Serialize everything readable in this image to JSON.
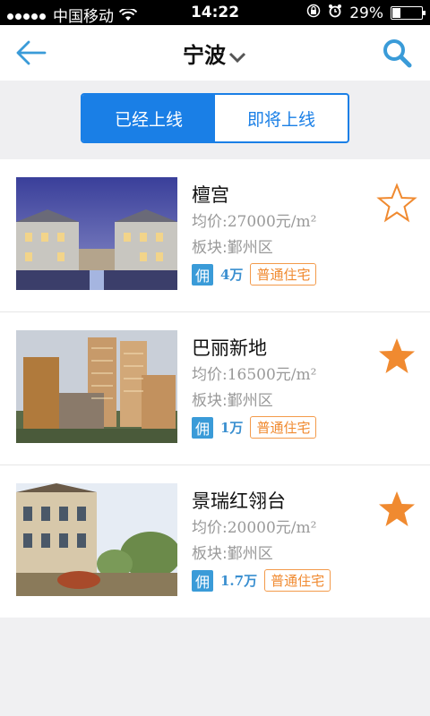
{
  "status": {
    "carrier": "中国移动",
    "time": "14:22",
    "battery": "29%",
    "battery_level": 0.29
  },
  "nav": {
    "city": "宁波"
  },
  "tabs": [
    {
      "label": "已经上线",
      "active": true
    },
    {
      "label": "即将上线",
      "active": false
    }
  ],
  "listings": [
    {
      "name": "檀宫",
      "price": "均价:27000元/m²",
      "district": "板块:鄞州区",
      "yong": "佣",
      "commission": "4万",
      "tag": "普通住宅",
      "favorited": false
    },
    {
      "name": "巴丽新地",
      "price": "均价:16500元/m²",
      "district": "板块:鄞州区",
      "yong": "佣",
      "commission": "1万",
      "tag": "普通住宅",
      "favorited": true
    },
    {
      "name": "景瑞红翎台",
      "price": "均价:20000元/m²",
      "district": "板块:鄞州区",
      "yong": "佣",
      "commission": "1.7万",
      "tag": "普通住宅",
      "favorited": true
    }
  ],
  "colors": {
    "accent": "#1a7fe6",
    "star": "#f08a30",
    "commission": "#3a8fd0"
  }
}
